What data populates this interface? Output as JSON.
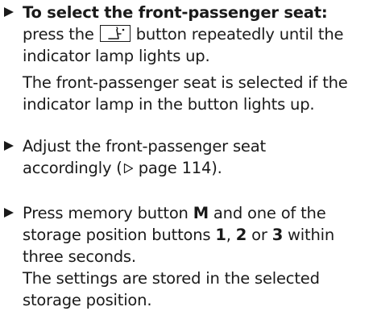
{
  "steps": [
    {
      "heading": "To select the front-passenger seat:",
      "instruction_before": "press the",
      "button_icon": "front-passenger-seat-icon",
      "instruction_after": "button repeatedly until the",
      "instruction_line2": "indicator lamp lights up.",
      "result_line1": "The front-passenger seat is selected if the",
      "result_line2": "indicator lamp in the button lights up."
    },
    {
      "line1": "Adjust the front-passenger seat",
      "line2_before": "accordingly (",
      "page_ref_icon": "triangle-right-outline-icon",
      "line2_after": " page 114)."
    },
    {
      "line1_before": "Press memory button ",
      "memory_button": "M",
      "line1_after": " and one of the",
      "line2_before": "storage position buttons ",
      "pos1": "1",
      "sep1": ", ",
      "pos2": "2",
      "sep2": " or ",
      "pos3": "3",
      "line2_after": " within",
      "line3": "three seconds.",
      "result_line1": "The settings are stored in the selected",
      "result_line2": "storage position."
    }
  ],
  "bullet_icon": "triangle-right-filled-icon",
  "colors": {
    "text": "#1a1a1a",
    "background": "#ffffff"
  }
}
